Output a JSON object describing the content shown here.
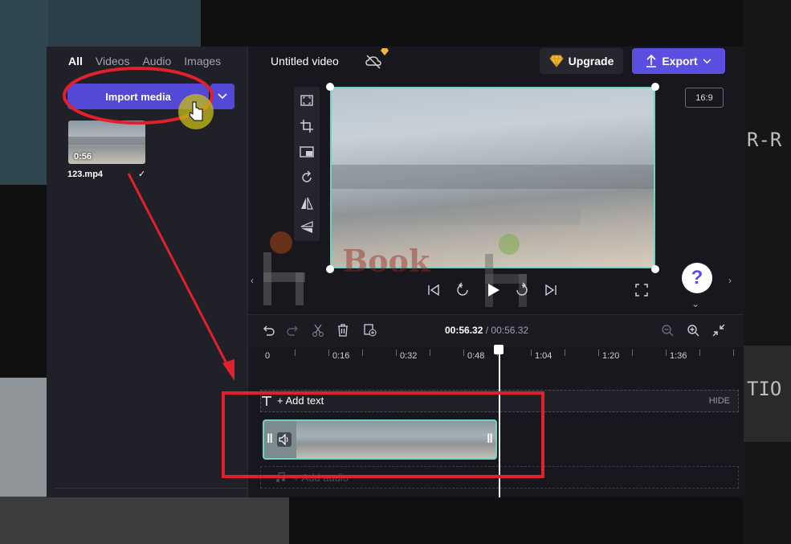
{
  "left_panel": {
    "tabs": [
      "All",
      "Videos",
      "Audio",
      "Images"
    ],
    "import_label": "Import media",
    "media": {
      "duration": "0:56",
      "filename": "123.mp4",
      "check": "✓"
    }
  },
  "topbar": {
    "title": "Untitled video",
    "upgrade_label": "Upgrade",
    "export_label": "Export",
    "aspect_ratio": "16:9"
  },
  "help": {
    "label": "?"
  },
  "timeline": {
    "current_time": "00:56.32",
    "separator": " / ",
    "total_time": "00:56.32",
    "ticks": [
      "0",
      "0:16",
      "0:32",
      "0:48",
      "1:04",
      "1:20",
      "1:36"
    ],
    "text_track_label": "+ Add text",
    "hide_label": "HIDE",
    "audio_track_label": "+ Add audio"
  },
  "background": {
    "label_right_1": "R-R",
    "label_right_2": "TIO"
  },
  "watermark": "Book",
  "colors": {
    "accent": "#5a4fe0",
    "selection": "#6fd3c0",
    "annotation": "#e0202a"
  }
}
